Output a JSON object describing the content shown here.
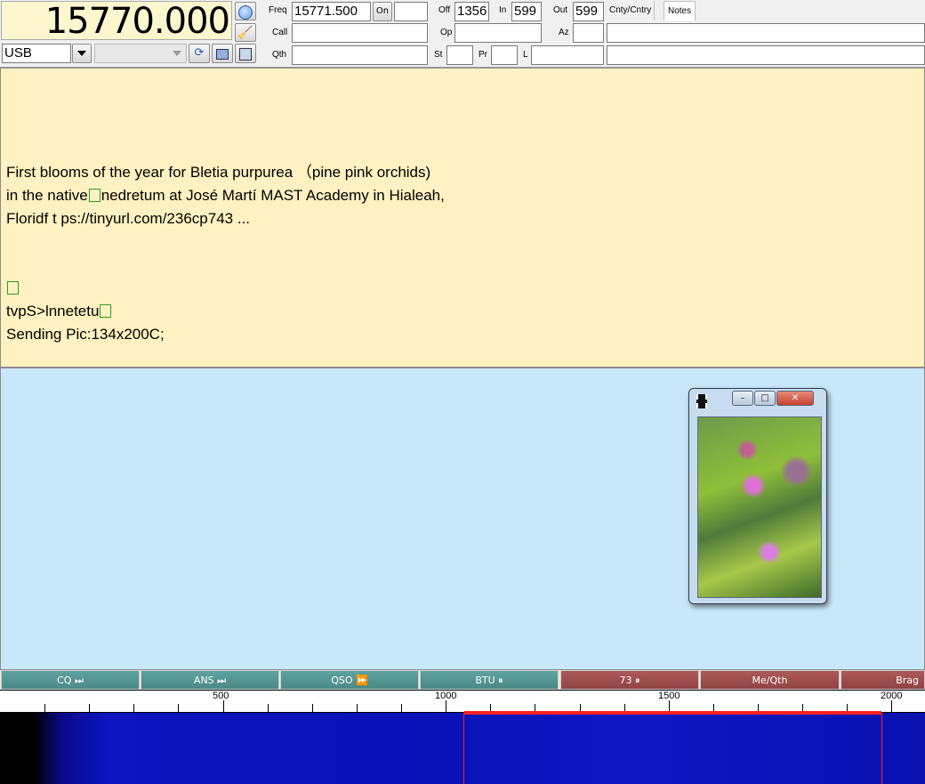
{
  "header": {
    "frequency": "15770.000",
    "mode": "USB",
    "submode": "",
    "freq_label": "Freq",
    "freq_value": "15771.500",
    "on_label": "On",
    "on_value": "",
    "off_label": "Off",
    "off_value": "1356",
    "in_label": "In",
    "in_value": "599",
    "out_label": "Out",
    "out_value": "599",
    "cnty_tab": "Cnty/Cntry",
    "notes_tab": "Notes",
    "call_label": "Call",
    "call_value": "",
    "op_label": "Op",
    "op_value": "",
    "az_label": "Az",
    "az_value": "",
    "qth_label": "Qth",
    "qth_value": "",
    "st_label": "St",
    "st_value": "",
    "pr_label": "Pr",
    "pr_value": "",
    "l_label": "L",
    "l_value": ""
  },
  "rx": {
    "line1": "First blooms of the year for Bletia purpurea （pine pink orchids)",
    "line2a": "in the native",
    "line2b": "nedretum at José Martí MAST Academy in Hialeah,",
    "line3": "Floridf t ps://tinyurl.com/236cp743 ...",
    "line5": "tvpS>lnnetetu",
    "line6": "Sending Pic:134x200C;"
  },
  "picture_window": {
    "icon": "film-icon",
    "minimize": "–",
    "maximize": "□",
    "close": "✕"
  },
  "macros": [
    {
      "label": "CQ ⏭",
      "color": "#5fa3a0"
    },
    {
      "label": "ANS ⏭",
      "color": "#5fa3a0"
    },
    {
      "label": "QSO ⏩",
      "color": "#5fa3a0"
    },
    {
      "label": "BTU ⏸",
      "color": "#5fa3a0"
    },
    {
      "label": "73 ⏸",
      "color": "#ad5959"
    },
    {
      "label": "Me/Qth",
      "color": "#ad5959"
    },
    {
      "label": "Brag",
      "color": "#ad5959"
    }
  ],
  "scale": {
    "labels": [
      "500",
      "1000",
      "1500",
      "2000"
    ],
    "label_values": [
      500,
      1000,
      1500,
      2000
    ],
    "range_hz": [
      0,
      2075
    ],
    "tick_step_hz": 100,
    "passband_hz": [
      1040,
      1975
    ]
  },
  "colors": {
    "rx_background": "#fff1c1",
    "tx_background": "#c8e8fa",
    "waterfall_cursor": "#ff2020"
  }
}
